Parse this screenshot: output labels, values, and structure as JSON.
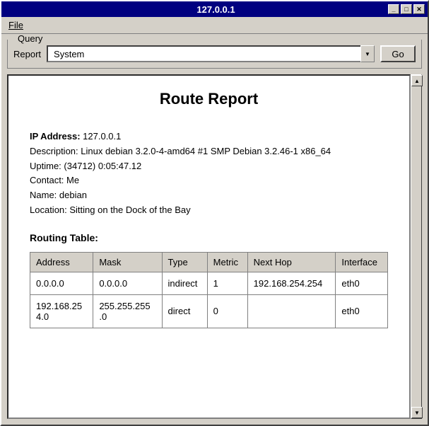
{
  "window": {
    "title": "127.0.0.1",
    "minimize_label": "_",
    "maximize_label": "□",
    "close_label": "✕"
  },
  "menu": {
    "file_label": "File"
  },
  "query": {
    "legend": "Query",
    "report_label": "Report",
    "report_value": "System",
    "report_options": [
      "System"
    ],
    "go_label": "Go"
  },
  "report": {
    "title": "Route Report",
    "ip_label": "IP Address:",
    "ip_value": "127.0.0.1",
    "description": "Description: Linux debian 3.2.0-4-amd64 #1 SMP Debian 3.2.46-1 x86_64",
    "uptime": "Uptime: (34712) 0:05:47.12",
    "contact": "Contact: Me",
    "name": "Name: debian",
    "location": "Location: Sitting on the Dock of the Bay",
    "routing_table_title": "Routing Table:",
    "table_headers": [
      "Address",
      "Mask",
      "Type",
      "Metric",
      "Next Hop",
      "Interface"
    ],
    "table_rows": [
      {
        "address": "0.0.0.0",
        "mask": "0.0.0.0",
        "type": "indirect",
        "metric": "1",
        "next_hop": "192.168.254.254",
        "interface": "eth0"
      },
      {
        "address": "192.168.25\n4.0",
        "mask": "255.255.255\n.0",
        "type": "direct",
        "metric": "0",
        "next_hop": "",
        "interface": "eth0"
      }
    ]
  }
}
